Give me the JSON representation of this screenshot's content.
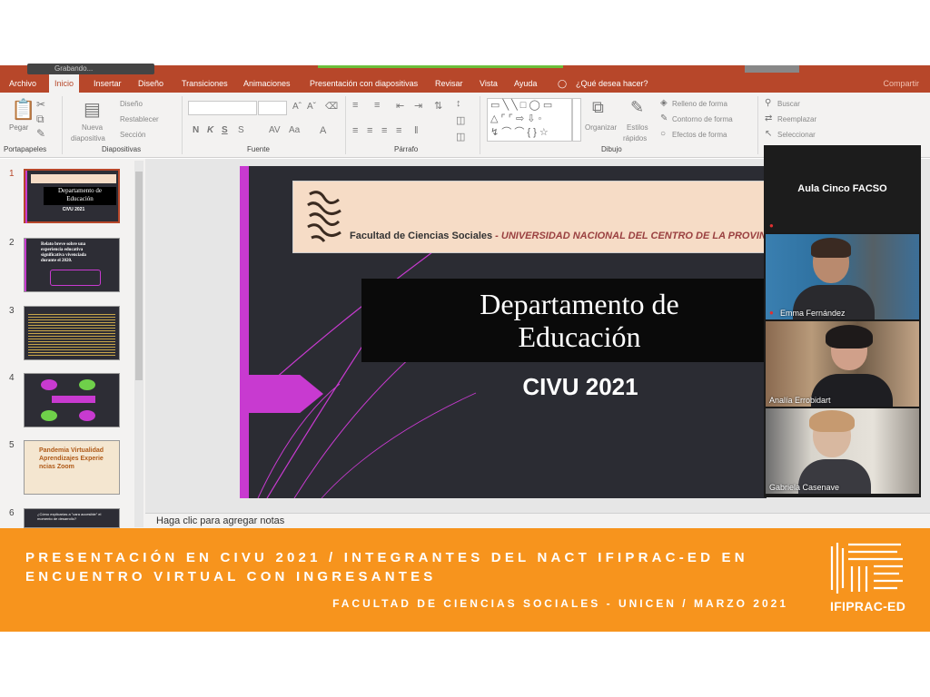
{
  "zoom_bar": {
    "recording_label": "Grabando..."
  },
  "ribbon": {
    "tabs": [
      "Archivo",
      "Inicio",
      "Insertar",
      "Diseño",
      "Transiciones",
      "Animaciones",
      "Presentación con diapositivas",
      "Revisar",
      "Vista",
      "Ayuda"
    ],
    "tell_me": "¿Qué desea hacer?",
    "share": "Compartir",
    "groups": {
      "clipboard": "Portapapeles",
      "slides": "Diapositivas",
      "font": "Fuente",
      "paragraph": "Párrafo",
      "drawing": "Dibujo"
    },
    "buttons": {
      "paste": "Pegar",
      "new_slide_1": "Nueva",
      "new_slide_2": "diapositiva",
      "design": "Diseño",
      "reset": "Restablecer",
      "section": "Sección",
      "organize": "Organizar",
      "styles_1": "Estilos",
      "styles_2": "rápidos",
      "shape_fill": "Relleno de forma",
      "shape_outline": "Contorno de forma",
      "shape_effects": "Efectos de forma",
      "find": "Buscar",
      "replace": "Reemplazar",
      "select": "Seleccionar",
      "bold": "N",
      "italic": "K",
      "underline": "S"
    }
  },
  "thumbnails": [
    {
      "num": "1",
      "title_1": "Departamento de",
      "title_2": "Educación",
      "sub": "CIVU 2021"
    },
    {
      "num": "2",
      "text": "Relato breve sobre una experiencia educativa significativa vivenciada durante el 2020."
    },
    {
      "num": "3"
    },
    {
      "num": "4"
    },
    {
      "num": "5",
      "words": "Pandemia Virtualidad Aprendizajes Experiencias Zoom"
    },
    {
      "num": "6",
      "text": "¿Cómo explicarías a \"cara accesible\" el momento de desarrollo?"
    }
  ],
  "slide": {
    "faculty": "Facultad de Ciencias Sociales",
    "university": " - UNIVERSIDAD NACIONAL DEL CENTRO DE LA PROVINCIA DE BUENOS",
    "title_line1": "Departamento de",
    "title_line2": "Educación",
    "subtitle": "CIVU 2021"
  },
  "notes_placeholder": "Haga clic para agregar notas",
  "zoom_panel": {
    "host": "Aula Cinco FACSO",
    "participants": [
      "Emma Fernández",
      "Analía Errobidart",
      "Gabriela Casenave"
    ]
  },
  "banner": {
    "title": "PRESENTACIÓN EN CIVU 2021 / INTEGRANTES DEL NACT IFIPRAC-ED EN ENCUENTRO VIRTUAL CON INGRESANTES",
    "subtitle": "FACULTAD DE CIENCIAS SOCIALES - UNICEN / MARZO 2021",
    "logo_text": "IFIPRAC-ED"
  },
  "colors": {
    "accent": "#b7472a",
    "banner": "#f7941d",
    "magenta": "#c83ad0",
    "slide_bg": "#2b2c33"
  }
}
